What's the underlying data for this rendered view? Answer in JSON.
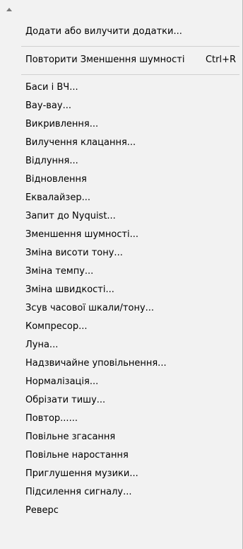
{
  "menu": {
    "manage_label": "Додати або вилучити додатки...",
    "repeat": {
      "label": "Повторити Зменшення шумності",
      "shortcut": "Ctrl+R"
    },
    "effects": [
      "Баси і ВЧ...",
      "Вау-вау...",
      "Викривлення...",
      "Вилучення клацання...",
      "Відлуння...",
      "Відновлення",
      "Еквалайзер...",
      "Запит до Nyquist...",
      "Зменшення шумності...",
      "Зміна висоти тону...",
      "Зміна темпу...",
      "Зміна швидкості...",
      "Зсув часової шкали/тону...",
      "Компресор...",
      "Луна...",
      "Надзвичайне уповільнення...",
      "Нормалізація...",
      "Обрізати тишу...",
      "Повтор......",
      "Повільне згасання",
      "Повільне наростання",
      "Приглушення музики...",
      "Підсилення сигналу...",
      "Реверс"
    ]
  }
}
